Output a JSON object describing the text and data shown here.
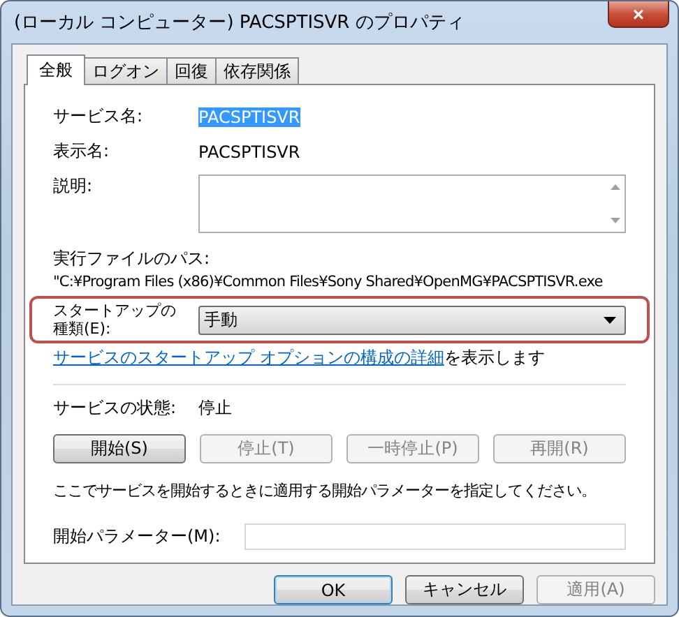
{
  "window": {
    "title": "(ローカル コンピューター) PACSPTISVR のプロパティ",
    "close": "×"
  },
  "tabs": [
    {
      "label": "全般",
      "selected": true
    },
    {
      "label": "ログオン",
      "selected": false
    },
    {
      "label": "回復",
      "selected": false
    },
    {
      "label": "依存関係",
      "selected": false
    }
  ],
  "service_name": {
    "label": "サービス名:",
    "value": "PACSPTISVR",
    "selected": true
  },
  "display_name": {
    "label": "表示名:",
    "value": "PACSPTISVR"
  },
  "description": {
    "label": "説明:"
  },
  "executable_path": {
    "label": "実行ファイルのパス:",
    "value": "\"C:¥Program Files (x86)¥Common Files¥Sony Shared¥OpenMG¥PACSPTISVR.exe"
  },
  "startup_type": {
    "label": "スタートアップの種類(E):",
    "value": "手動",
    "highlighted": true
  },
  "help_text": {
    "link": "サービスのスタートアップ オプションの構成の詳細",
    "rest": "を表示します"
  },
  "service_status": {
    "label": "サービスの状態:",
    "value": "停止"
  },
  "control_buttons": [
    {
      "label": "開始(S)",
      "disabled": false
    },
    {
      "label": "停止(T)",
      "disabled": true
    },
    {
      "label": "一時停止(P)",
      "disabled": true
    },
    {
      "label": "再開(R)",
      "disabled": true
    }
  ],
  "parameters_hint": "ここでサービスを開始するときに適用する開始パラメーターを指定してください。",
  "start_parameters": {
    "label": "開始パラメーター(M):"
  },
  "buttons": [
    {
      "label": "OK",
      "disabled": false,
      "default": true
    },
    {
      "label": "キャンセル",
      "disabled": false,
      "default": false
    },
    {
      "label": "適用(A)",
      "disabled": true,
      "default": false
    }
  ]
}
